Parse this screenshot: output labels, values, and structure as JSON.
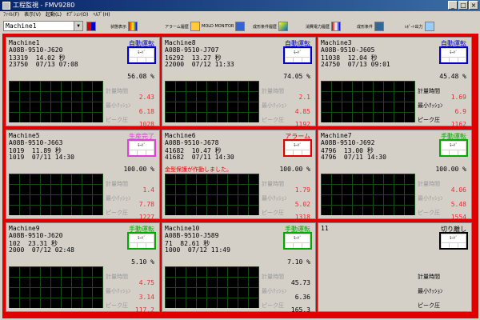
{
  "window": {
    "title": "工程監視 - FMV9280"
  },
  "menu": [
    "ﾌｧｲﾙ(F)",
    "表示(V)",
    "起動(L)",
    "ｵﾌﾟｼｮﾝ(O)",
    "ﾍﾙﾌﾟ(H)"
  ],
  "toolbar": {
    "machine": "Machine1",
    "buttons": [
      "状態表示",
      "アラーム履歴",
      "MOLD MONITOR",
      "成形条件履歴",
      "消費電力履歴",
      "成形条件",
      "ﾚﾎﾟｰﾄ出力"
    ]
  },
  "labels": {
    "time": "計量時間",
    "cushion": "最小ｸｯｼｮﾝ",
    "peak": "ピーク圧",
    "sec": "秒"
  },
  "panels": [
    {
      "name": "Machine1",
      "code": "A08B-9510-J620",
      "a": "13319",
      "b": "14.02",
      "c": "23750",
      "d": "07/13 07:08",
      "status": "自動運転",
      "pct": "56.08 %",
      "time": "2.43",
      "cushion": "6.18",
      "peak": "1028"
    },
    {
      "name": "Machine8",
      "code": "A08B-9510-J707",
      "a": "16292",
      "b": "13.27",
      "c": "22000",
      "d": "07/12 11:33",
      "status": "自動運転",
      "pct": "74.05 %",
      "time": "2.1",
      "cushion": "4.85",
      "peak": "1192"
    },
    {
      "name": "Machine3",
      "code": "A08B-9510-J605",
      "a": "11038",
      "b": "12.04",
      "c": "24750",
      "d": "07/13 09:01",
      "status": "自動運転",
      "pct": "45.48 %",
      "time": "1.69",
      "cushion": "6.9",
      "peak": "1162"
    },
    {
      "name": "Machine5",
      "code": "A08B-9510-J663",
      "a": "1019",
      "b": "11.89",
      "c": "1019",
      "d": "07/11 14:30",
      "status": "生産完了",
      "pct": "100.00 %",
      "time": "1.4",
      "cushion": "7.78",
      "peak": "1227"
    },
    {
      "name": "Machine6",
      "code": "A08B-9510-J678",
      "a": "41682",
      "b": "10.47",
      "c": "41682",
      "d": "07/11 14:30",
      "status": "アラーム",
      "pct": "100.00 %",
      "message": "金型保護が作動しました。",
      "time": "1.79",
      "cushion": "5.02",
      "peak": "1318"
    },
    {
      "name": "Machine7",
      "code": "A08B-9510-J692",
      "a": "4796",
      "b": "13.00",
      "c": "4796",
      "d": "07/11 14:30",
      "status": "手動運転",
      "pct": "100.00 %",
      "time": "4.06",
      "cushion": "5.48",
      "peak": "1554"
    },
    {
      "name": "Machine9",
      "code": "A08B-9510-J620",
      "a": "102",
      "b": "23.31",
      "c": "2000",
      "d": "07/12 02:48",
      "status": "手動運転",
      "pct": "5.10 %",
      "time": "4.75",
      "cushion": "3.14",
      "peak": "117.2"
    },
    {
      "name": "Machine10",
      "code": "A08B-9510-J589",
      "a": "71",
      "b": "82.61",
      "c": "1000",
      "d": "07/12 11:49",
      "status": "手動運転",
      "pct": "7.10 %",
      "time": "45.73",
      "cushion": "6.36",
      "peak": "165.3"
    },
    {
      "name": "11",
      "status": "切り離し"
    }
  ],
  "colors": {
    "auto": "#0000cc",
    "done": "#e040e0",
    "alarm": "#e00000",
    "manual": "#00aa00",
    "off": "#000000"
  }
}
